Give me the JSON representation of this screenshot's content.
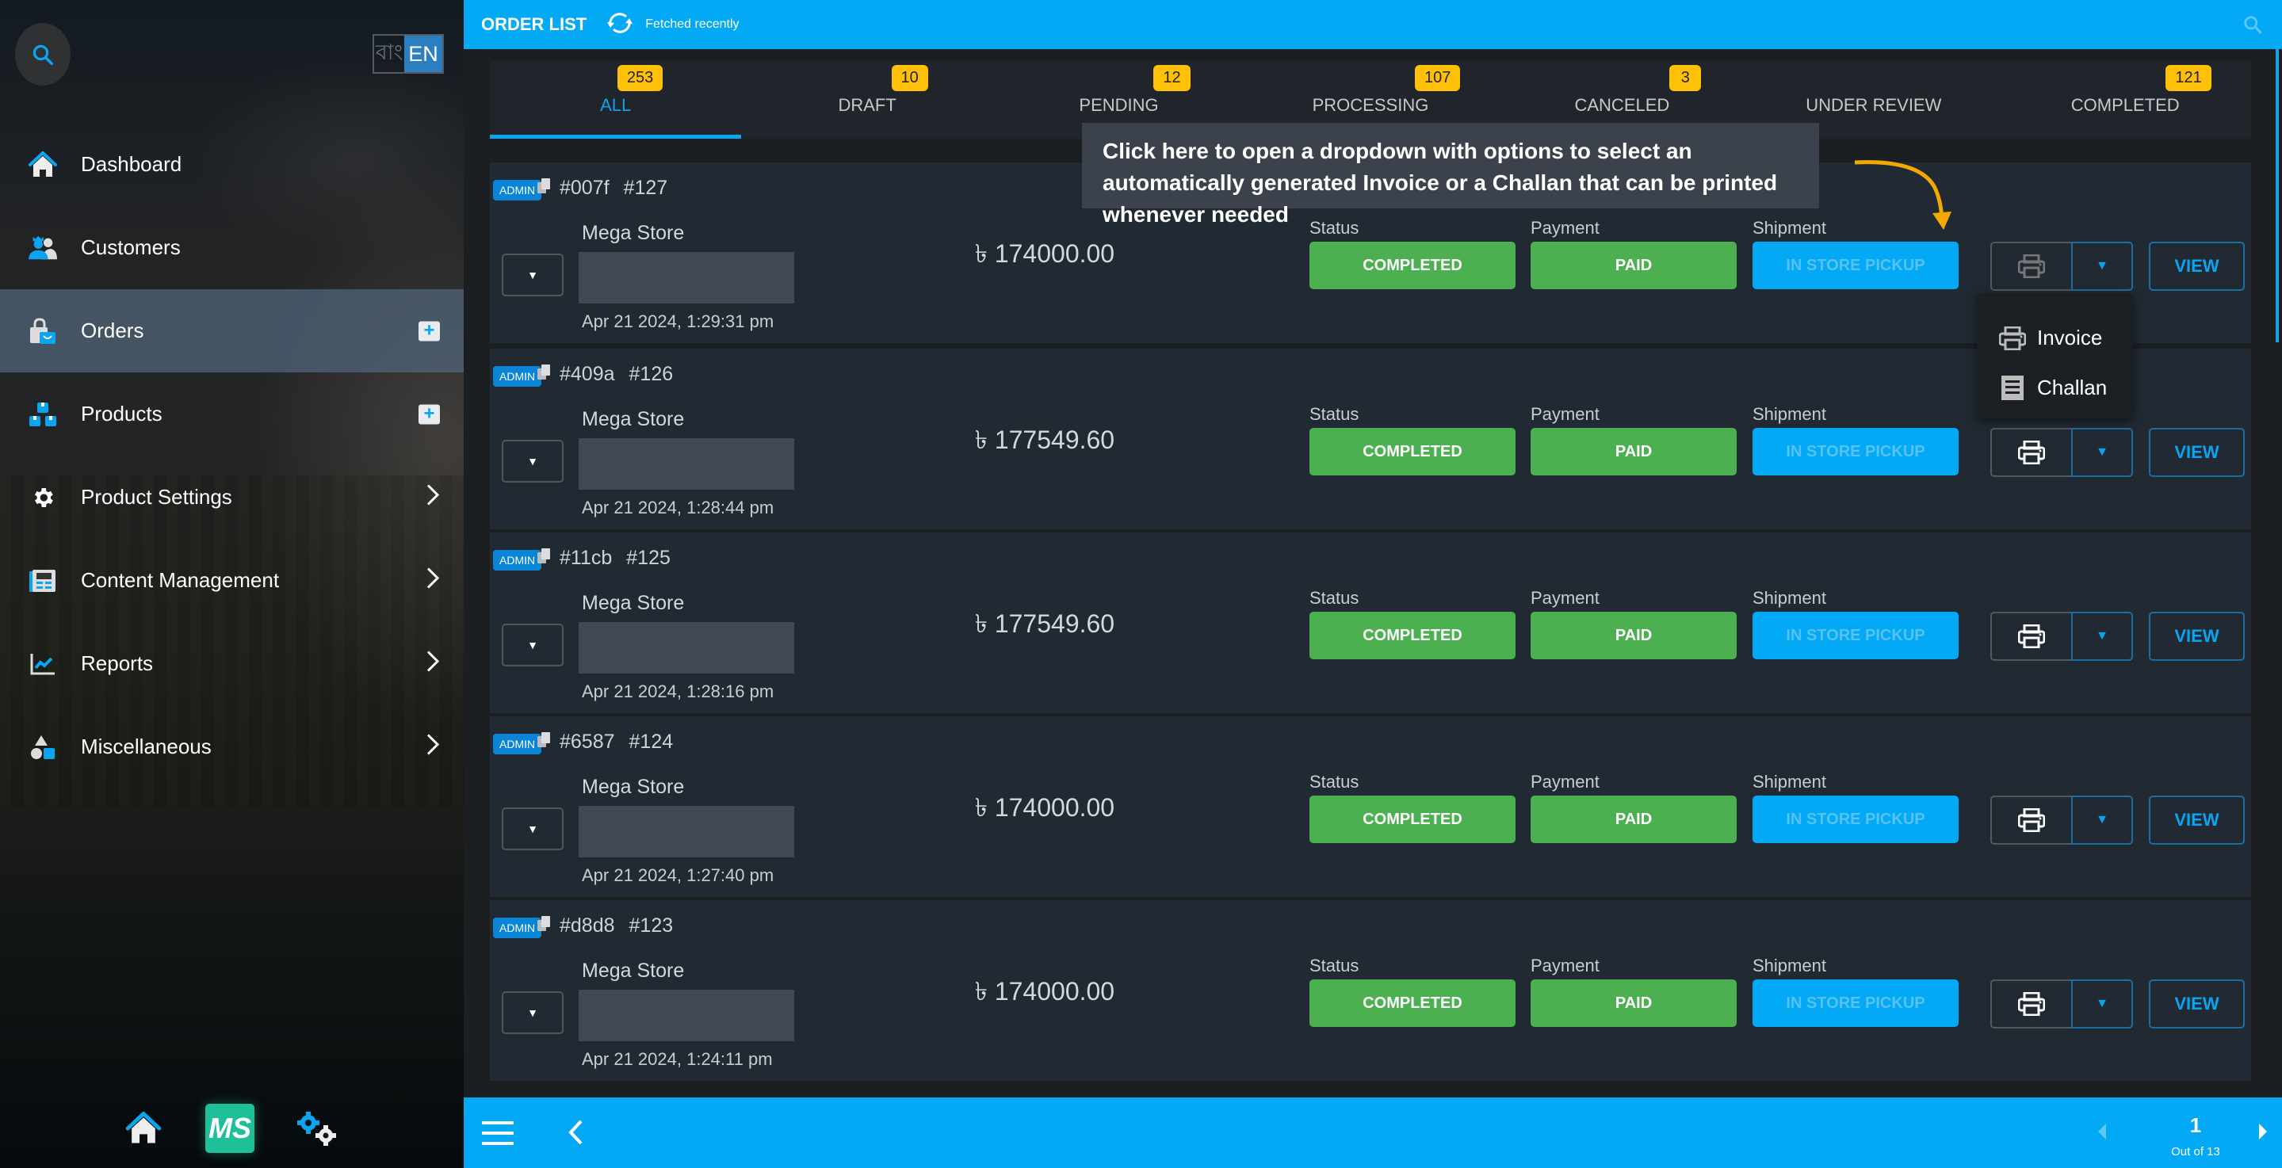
{
  "sidebar": {
    "lang": {
      "bn": "বাং",
      "en": "EN"
    },
    "items": [
      {
        "label": "Dashboard",
        "icon": "home-icon",
        "trail": ""
      },
      {
        "label": "Customers",
        "icon": "customers-icon",
        "trail": ""
      },
      {
        "label": "Orders",
        "icon": "orders-bag-icon",
        "trail": "plus",
        "active": true
      },
      {
        "label": "Products",
        "icon": "products-boxes-icon",
        "trail": "plus"
      },
      {
        "label": "Product Settings",
        "icon": "gear-icon",
        "trail": "chevron"
      },
      {
        "label": "Content Management",
        "icon": "content-icon",
        "trail": "chevron"
      },
      {
        "label": "Reports",
        "icon": "chart-icon",
        "trail": "chevron"
      },
      {
        "label": "Miscellaneous",
        "icon": "shapes-icon",
        "trail": "chevron"
      }
    ],
    "plus_symbol": "+",
    "logo_text": "MS"
  },
  "header": {
    "title": "ORDER LIST",
    "fetched": "Fetched recently"
  },
  "tabs": [
    {
      "label": "ALL",
      "count": "253",
      "active": true
    },
    {
      "label": "DRAFT",
      "count": "10"
    },
    {
      "label": "PENDING",
      "count": "12"
    },
    {
      "label": "PROCESSING",
      "count": "107"
    },
    {
      "label": "CANCELED",
      "count": "3"
    },
    {
      "label": "UNDER REVIEW",
      "count": ""
    },
    {
      "label": "COMPLETED",
      "count": "121"
    }
  ],
  "labels": {
    "status": "Status",
    "payment": "Payment",
    "shipment": "Shipment",
    "view": "VIEW",
    "admin": "ADMIN",
    "expand_caret": "▼",
    "dropdown_caret": "▼"
  },
  "orders": [
    {
      "hash": "#007f",
      "number": "#127",
      "store": "Mega Store",
      "date": "Apr 21 2024, 1:29:31 pm",
      "amount": "৳ 174000.00",
      "status": "COMPLETED",
      "payment": "PAID",
      "shipment": "IN STORE PICKUP"
    },
    {
      "hash": "#409a",
      "number": "#126",
      "store": "Mega Store",
      "date": "Apr 21 2024, 1:28:44 pm",
      "amount": "৳ 177549.60",
      "status": "COMPLETED",
      "payment": "PAID",
      "shipment": "IN STORE PICKUP"
    },
    {
      "hash": "#11cb",
      "number": "#125",
      "store": "Mega Store",
      "date": "Apr 21 2024, 1:28:16 pm",
      "amount": "৳ 177549.60",
      "status": "COMPLETED",
      "payment": "PAID",
      "shipment": "IN STORE PICKUP"
    },
    {
      "hash": "#6587",
      "number": "#124",
      "store": "Mega Store",
      "date": "Apr 21 2024, 1:27:40 pm",
      "amount": "৳ 174000.00",
      "status": "COMPLETED",
      "payment": "PAID",
      "shipment": "IN STORE PICKUP"
    },
    {
      "hash": "#d8d8",
      "number": "#123",
      "store": "Mega Store",
      "date": "Apr 21 2024, 1:24:11 pm",
      "amount": "৳ 174000.00",
      "status": "COMPLETED",
      "payment": "PAID",
      "shipment": "IN STORE PICKUP"
    }
  ],
  "print_menu": {
    "items": [
      {
        "label": "Invoice",
        "icon": "printer-icon"
      },
      {
        "label": "Challan",
        "icon": "receipt-icon"
      }
    ]
  },
  "tooltip": {
    "text": "Click here to open a dropdown with options to select an automatically generated Invoice or a Challan that can be printed whenever needed"
  },
  "pagination": {
    "page": "1",
    "out_of": "Out of 13"
  },
  "colors": {
    "accent": "#03a9f4",
    "badge": "#ffc107",
    "success": "#4caf50",
    "admin": "#0a84d6",
    "logo": "#1fbf99",
    "arrow": "#f5a800"
  }
}
